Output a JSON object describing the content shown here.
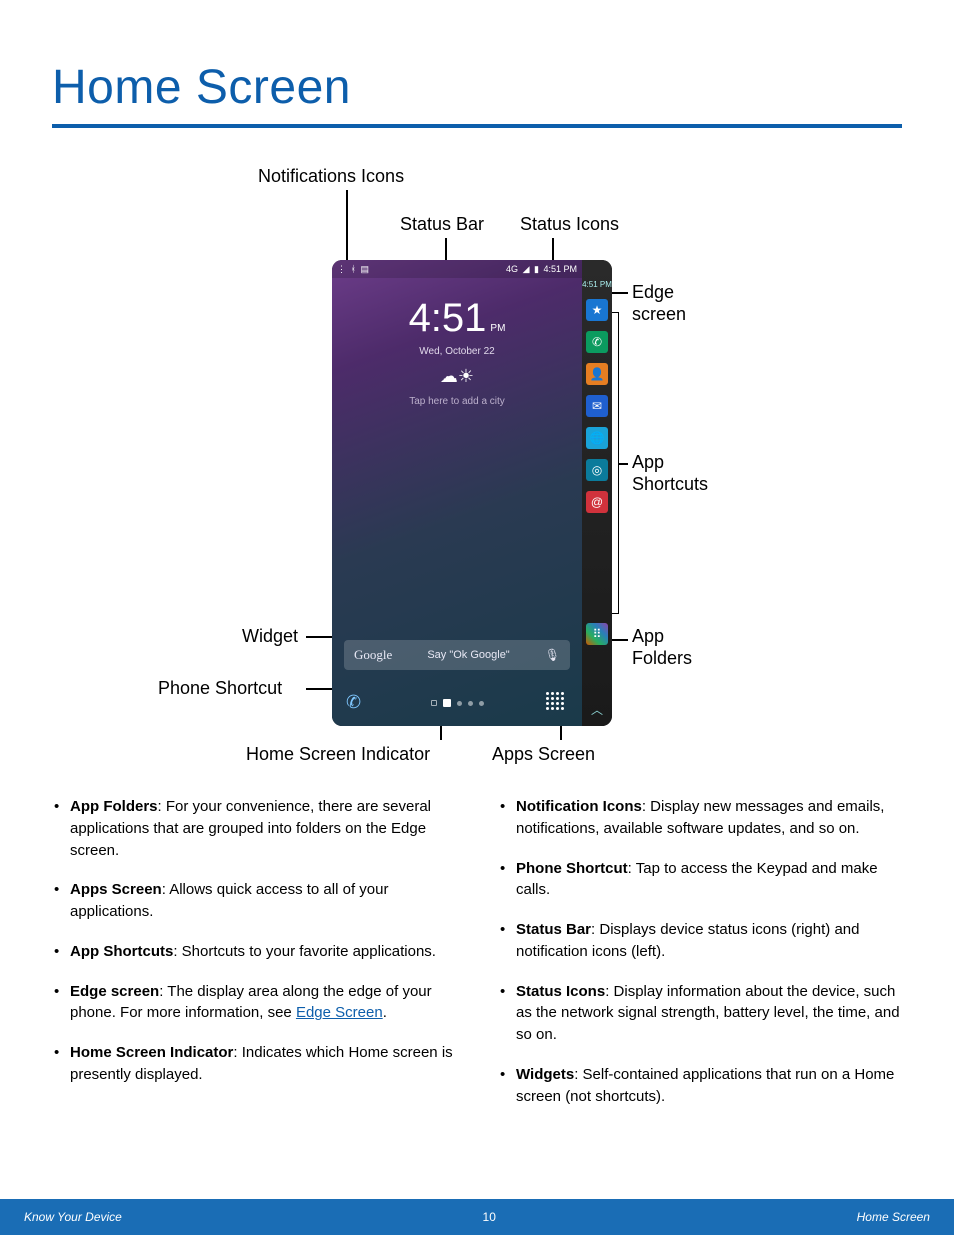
{
  "page": {
    "title": "Home Screen"
  },
  "callouts": {
    "notifications_icons": "Notifications Icons",
    "status_bar": "Status Bar",
    "status_icons": "Status Icons",
    "edge_screen1": "Edge",
    "edge_screen2": "screen",
    "app_shortcuts1": "App",
    "app_shortcuts2": "Shortcuts",
    "app_folders1": "App",
    "app_folders2": "Folders",
    "widget": "Widget",
    "phone_shortcut": "Phone Shortcut",
    "home_screen_indicator": "Home Screen Indicator",
    "apps_screen": "Apps Screen"
  },
  "phone": {
    "status_left_icons": [
      "wifi-icon",
      "bluetooth-icon",
      "vibrate-icon"
    ],
    "status_right_signal": "4G",
    "status_time": "4:51 PM",
    "clock_time": "4:51",
    "clock_ampm": "PM",
    "clock_date": "Wed, October 22",
    "weather_hint": "Tap here to add a city",
    "google_logo": "Google",
    "google_hint": "Say \"Ok Google\"",
    "edge_items": [
      {
        "bg": "#1976d2",
        "glyph": "★"
      },
      {
        "bg": "#0b9b5f",
        "glyph": "✆"
      },
      {
        "bg": "#e67e22",
        "glyph": "👤"
      },
      {
        "bg": "#1f5fcf",
        "glyph": "✉"
      },
      {
        "bg": "#1aa3d8",
        "glyph": "🌐"
      },
      {
        "bg": "#0b7b9b",
        "glyph": "◎"
      },
      {
        "bg": "#d0323c",
        "glyph": "@"
      }
    ],
    "edge_time": "4:51 PM"
  },
  "descriptions": {
    "left": [
      {
        "term": "App Folders",
        "text": ": For your convenience, there are several applications that are grouped into folders on the Edge screen."
      },
      {
        "term": "Apps Screen",
        "text": ": Allows quick access to all of your applications."
      },
      {
        "term": "App Shortcuts",
        "text": ": Shortcuts to your favorite applications."
      },
      {
        "term": "Edge screen",
        "text_pre": ": The display area along the edge of your phone. For more information, see ",
        "link": "Edge Screen",
        "text_post": "."
      },
      {
        "term": "Home Screen Indicator",
        "text": ": Indicates which Home screen is presently displayed."
      }
    ],
    "right": [
      {
        "term": "Notification Icons",
        "text": ": Display new messages and emails, notifications, available software updates, and so on."
      },
      {
        "term": "Phone Shortcut",
        "text": ": Tap to access the Keypad and make calls."
      },
      {
        "term": "Status Bar",
        "text": ": Displays device status icons (right) and notification icons (left)."
      },
      {
        "term": "Status Icons",
        "text": ": Display information about the device, such as the network signal strength, battery level, the time, and so on."
      },
      {
        "term": "Widgets",
        "text": ": Self-contained applications that run on a Home screen (not shortcuts)."
      }
    ]
  },
  "footer": {
    "left": "Know Your Device",
    "center": "10",
    "right": "Home Screen"
  }
}
